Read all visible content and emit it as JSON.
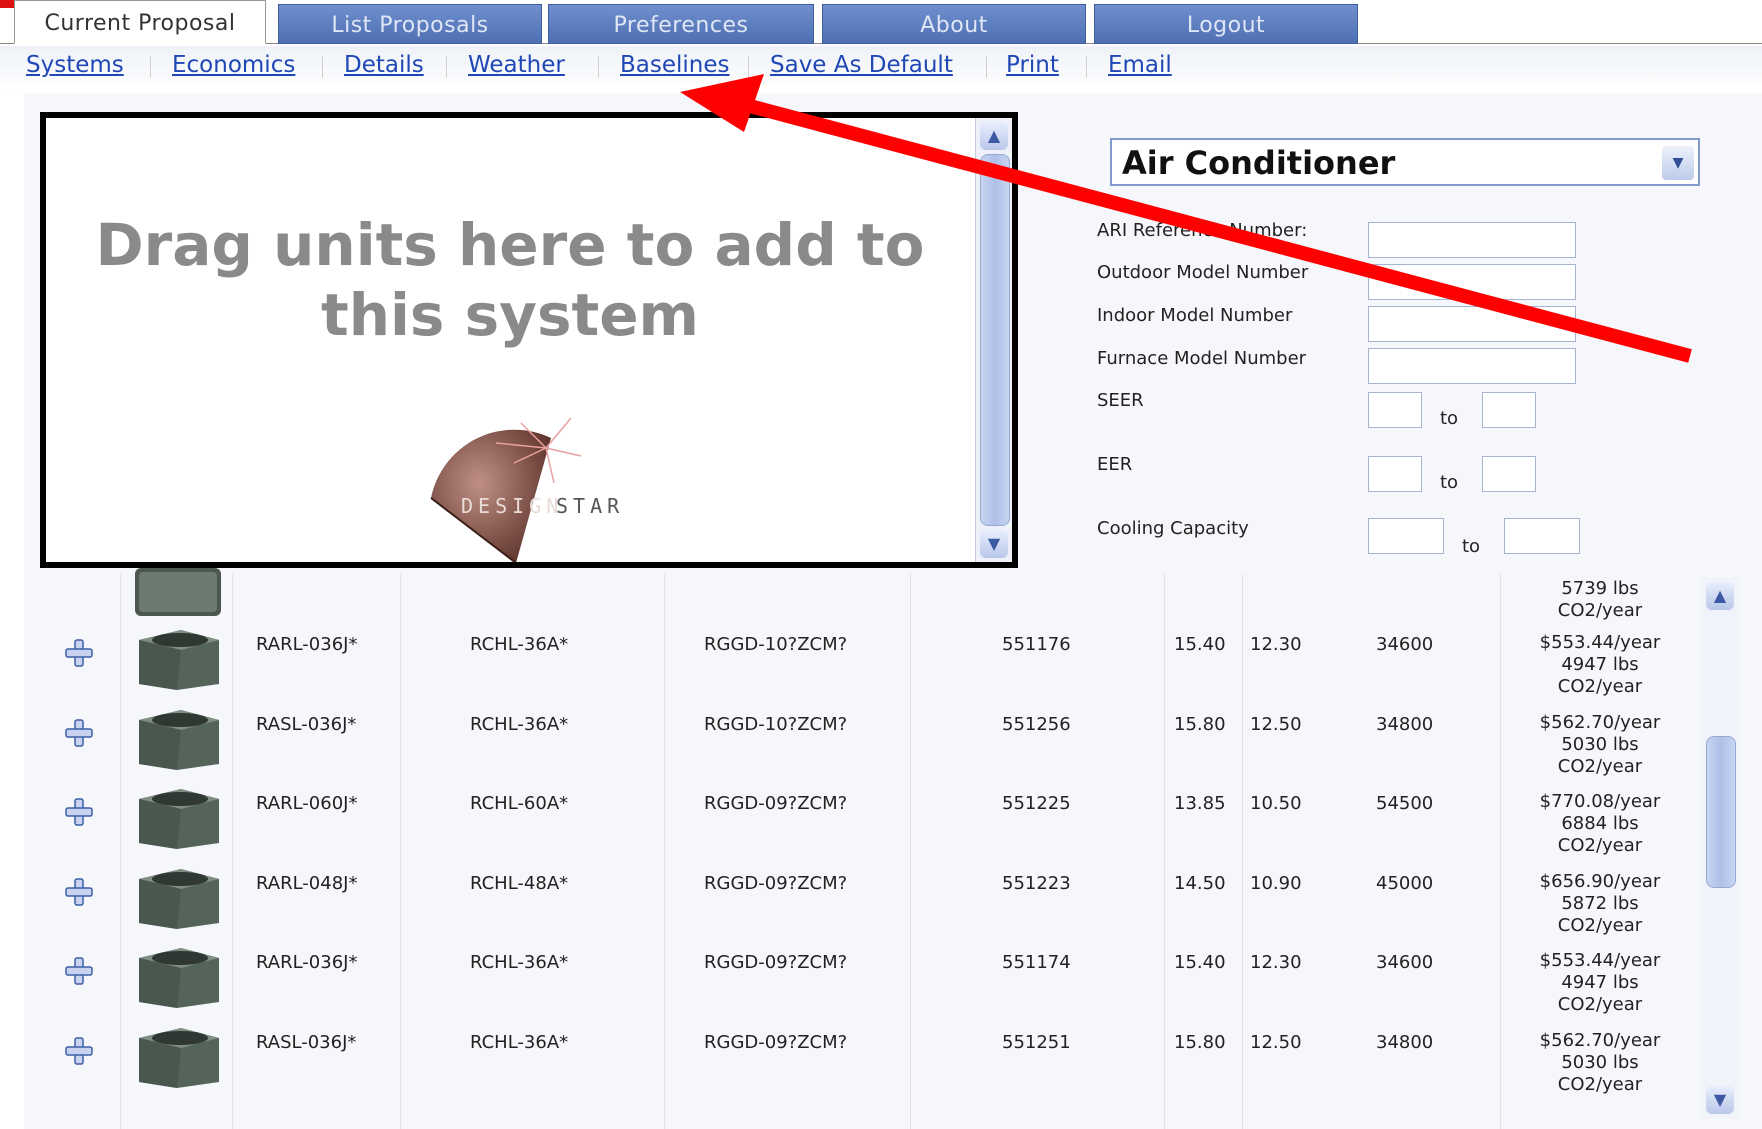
{
  "tabs": [
    {
      "label": "Current Proposal",
      "active": true
    },
    {
      "label": "List Proposals",
      "active": false
    },
    {
      "label": "Preferences",
      "active": false
    },
    {
      "label": "About",
      "active": false
    },
    {
      "label": "Logout",
      "active": false
    }
  ],
  "links": [
    "Systems",
    "Economics",
    "Details",
    "Weather",
    "Baselines",
    "Save As Default",
    "Print",
    "Email"
  ],
  "dropzone": {
    "line1": "Drag units here to add to",
    "line2": "this system",
    "logo_icon": "designstar-logo",
    "logo_text": "DESIGNSTAR"
  },
  "filter": {
    "type_selected": "Air Conditioner",
    "labels": {
      "ari": "ARI Reference Number:",
      "outdoor": "Outdoor Model Number",
      "indoor": "Indoor Model Number",
      "furnace": "Furnace Model Number",
      "seer": "SEER",
      "eer": "EER",
      "cooling": "Cooling Capacity"
    },
    "to": "to"
  },
  "partial_row": {
    "cost_line2": "5739 lbs",
    "cost_line3": "CO2/year"
  },
  "rows": [
    {
      "outdoor": "RARL-036J*",
      "indoor": "RCHL-36A*",
      "furnace": "RGGD-10?ZCM?",
      "ari": "551176",
      "seer": "15.40",
      "eer": "12.30",
      "capacity": "34600",
      "cost": "$553.44/year",
      "co2": "4947 lbs",
      "unit": "CO2/year"
    },
    {
      "outdoor": "RASL-036J*",
      "indoor": "RCHL-36A*",
      "furnace": "RGGD-10?ZCM?",
      "ari": "551256",
      "seer": "15.80",
      "eer": "12.50",
      "capacity": "34800",
      "cost": "$562.70/year",
      "co2": "5030 lbs",
      "unit": "CO2/year"
    },
    {
      "outdoor": "RARL-060J*",
      "indoor": "RCHL-60A*",
      "furnace": "RGGD-09?ZCM?",
      "ari": "551225",
      "seer": "13.85",
      "eer": "10.50",
      "capacity": "54500",
      "cost": "$770.08/year",
      "co2": "6884 lbs",
      "unit": "CO2/year"
    },
    {
      "outdoor": "RARL-048J*",
      "indoor": "RCHL-48A*",
      "furnace": "RGGD-09?ZCM?",
      "ari": "551223",
      "seer": "14.50",
      "eer": "10.90",
      "capacity": "45000",
      "cost": "$656.90/year",
      "co2": "5872 lbs",
      "unit": "CO2/year"
    },
    {
      "outdoor": "RARL-036J*",
      "indoor": "RCHL-36A*",
      "furnace": "RGGD-09?ZCM?",
      "ari": "551174",
      "seer": "15.40",
      "eer": "12.30",
      "capacity": "34600",
      "cost": "$553.44/year",
      "co2": "4947 lbs",
      "unit": "CO2/year"
    },
    {
      "outdoor": "RASL-036J*",
      "indoor": "RCHL-36A*",
      "furnace": "RGGD-09?ZCM?",
      "ari": "551251",
      "seer": "15.80",
      "eer": "12.50",
      "capacity": "34800",
      "cost": "$562.70/year",
      "co2": "5030 lbs",
      "unit": "CO2/year"
    }
  ],
  "colors": {
    "tab_blue": "#4e6fb2",
    "link_blue": "#1f47b5",
    "annotation_red": "#ff0000"
  }
}
